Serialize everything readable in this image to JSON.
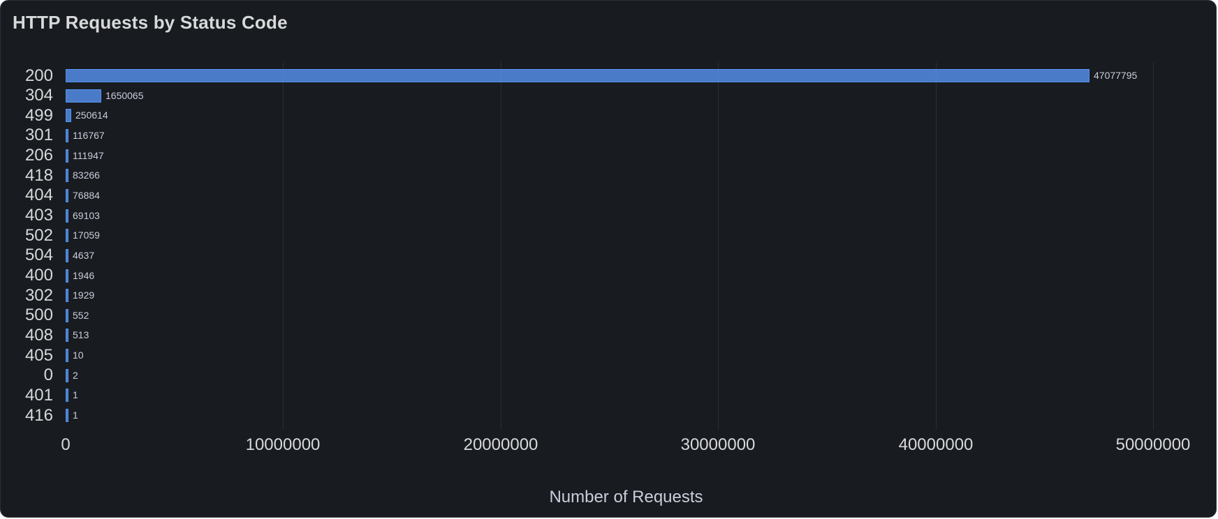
{
  "panel": {
    "title": "HTTP Requests by Status Code"
  },
  "chart_data": {
    "type": "bar",
    "orientation": "horizontal",
    "title": "HTTP Requests by Status Code",
    "categories": [
      "200",
      "304",
      "499",
      "301",
      "206",
      "418",
      "404",
      "403",
      "502",
      "504",
      "400",
      "302",
      "500",
      "408",
      "405",
      "0",
      "401",
      "416"
    ],
    "values": [
      47077795,
      1650065,
      250614,
      116767,
      111947,
      83266,
      76884,
      69103,
      17059,
      4637,
      1946,
      1929,
      552,
      513,
      10,
      2,
      1,
      1
    ],
    "value_labels": [
      "47077795",
      "1650065",
      "250614",
      "116767",
      "111947",
      "83266",
      "76884",
      "69103",
      "17059",
      "4637",
      "1946",
      "1929",
      "552",
      "513",
      "10",
      "2",
      "1",
      "1"
    ],
    "xlabel": "Number of Requests",
    "ylabel": "",
    "xlim": [
      0,
      50000000
    ],
    "x_ticks": [
      0,
      10000000,
      20000000,
      30000000,
      40000000,
      50000000
    ],
    "x_tick_labels": [
      "0",
      "10000000",
      "20000000",
      "30000000",
      "40000000",
      "50000000"
    ],
    "grid": true,
    "legend": false,
    "colors": {
      "bar_border": "#5794f2",
      "bar_fill": "rgba(87,148,242,0.8)",
      "background": "#181b1f",
      "text": "#d8d9da",
      "value_text": "#ccccdc",
      "gridline": "rgba(204,212,235,0.10)"
    }
  }
}
